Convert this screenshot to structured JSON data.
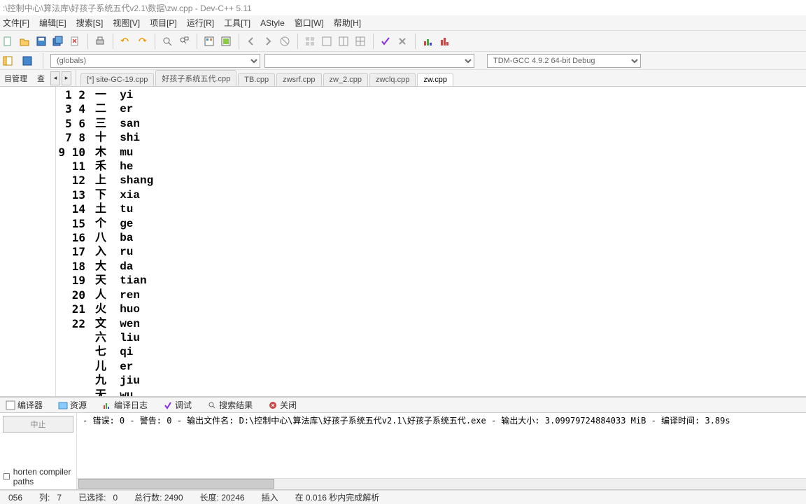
{
  "title": ":\\控制中心\\算法库\\好孩子系统五代v2.1\\数据\\zw.cpp - Dev-C++ 5.11",
  "menu": [
    "文件[F]",
    "编辑[E]",
    "搜索[S]",
    "视图[V]",
    "项目[P]",
    "运行[R]",
    "工具[T]",
    "AStyle",
    "窗口[W]",
    "帮助[H]"
  ],
  "globals_combo": "(globals)",
  "compiler_combo": "TDM-GCC 4.9.2 64-bit Debug",
  "left_tabs": {
    "a": "目管理",
    "b": "查"
  },
  "file_tabs": [
    "[*] site-GC-19.cpp",
    "好孩子系统五代.cpp",
    "TB.cpp",
    "zwsrf.cpp",
    "zw_2.cpp",
    "zwclq.cpp",
    "zw.cpp"
  ],
  "active_tab_index": 6,
  "code_lines": [
    {
      "n": 1,
      "t": "一  yi"
    },
    {
      "n": 2,
      "t": "二  er"
    },
    {
      "n": 3,
      "t": "三  san"
    },
    {
      "n": 4,
      "t": "十  shi"
    },
    {
      "n": 5,
      "t": "木  mu"
    },
    {
      "n": 6,
      "t": "禾  he"
    },
    {
      "n": 7,
      "t": "上  shang"
    },
    {
      "n": 8,
      "t": "下  xia"
    },
    {
      "n": 9,
      "t": "土  tu"
    },
    {
      "n": 10,
      "t": "个  ge"
    },
    {
      "n": 11,
      "t": "八  ba"
    },
    {
      "n": 12,
      "t": "入  ru"
    },
    {
      "n": 13,
      "t": "大  da"
    },
    {
      "n": 14,
      "t": "天  tian"
    },
    {
      "n": 15,
      "t": "人  ren"
    },
    {
      "n": 16,
      "t": "火  huo"
    },
    {
      "n": 17,
      "t": "文  wen"
    },
    {
      "n": 18,
      "t": "六  liu"
    },
    {
      "n": 19,
      "t": "七  qi"
    },
    {
      "n": 20,
      "t": "儿  er"
    },
    {
      "n": 21,
      "t": "九  jiu"
    },
    {
      "n": 22,
      "t": "无  wu"
    }
  ],
  "bottom_tabs": [
    "编译器",
    "资源",
    "编译日志",
    "调试",
    "搜索结果",
    "关闭"
  ],
  "compile_left": {
    "abort": "中止",
    "shorten": "horten compiler paths"
  },
  "compile_out": [
    "- 错误: 0",
    "- 警告: 0",
    "- 输出文件名: D:\\控制中心\\算法库\\好孩子系统五代v2.1\\好孩子系统五代.exe",
    "- 输出大小: 3.09979724884033 MiB",
    "- 编译时间: 3.89s"
  ],
  "status": {
    "line_lbl": "056",
    "col_lbl": "列:",
    "col": "7",
    "sel_lbl": "已选择:",
    "sel": "0",
    "totl_lbl": "总行数:",
    "totl": "2490",
    "len_lbl": "长度:",
    "len": "20246",
    "ins": "插入",
    "parse": "在 0.016 秒内完成解析"
  }
}
